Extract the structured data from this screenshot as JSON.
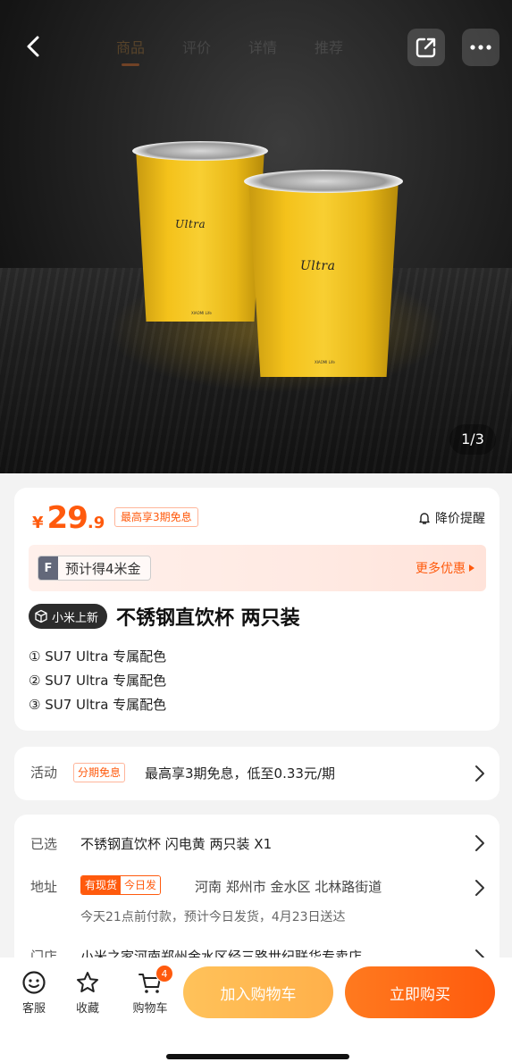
{
  "hero": {
    "cup_logo": "Ultra",
    "cup_small_text": "XIAOMI Life",
    "page_indicator": "1/3"
  },
  "nav": {
    "tabs": [
      "商品",
      "评价",
      "详情",
      "推荐"
    ]
  },
  "price": {
    "currency": "¥",
    "integer": "29",
    "decimal": ".9",
    "promo_tag": "最高享3期免息",
    "alert_label": "降价提醒"
  },
  "coins": {
    "badge": "F",
    "text": "预计得4米金",
    "more": "更多优惠"
  },
  "product": {
    "new_badge": "小米上新",
    "title": "不锈钢直饮杯 两只装",
    "variants": [
      "① SU7 Ultra 专属配色",
      "② SU7 Ultra 专属配色",
      "③ SU7 Ultra 专属配色"
    ]
  },
  "activity": {
    "label": "活动",
    "tag": "分期免息",
    "text": "最高享3期免息，低至0.33元/期"
  },
  "details": {
    "selected_label": "已选",
    "selected_text": "不锈钢直饮杯 闪电黄 两只装 X1",
    "address_label": "地址",
    "stock_tag": "有现货",
    "ship_tag": "今日发",
    "address_text": "河南 郑州市 金水区 北林路街道",
    "delivery_text": "今天21点前付款，预计今日发货，4月23日送达",
    "store_label": "门店",
    "store_text": "小米之家河南郑州金水区经三路世纪联华专卖店"
  },
  "bottom": {
    "service": "客服",
    "favorite": "收藏",
    "cart": "购物车",
    "cart_count": "4",
    "add_to_cart": "加入购物车",
    "buy_now": "立即购买"
  },
  "colors": {
    "accent": "#ff5a0d",
    "cup": "#f4c21b",
    "cart_button": "#ffb04a"
  }
}
